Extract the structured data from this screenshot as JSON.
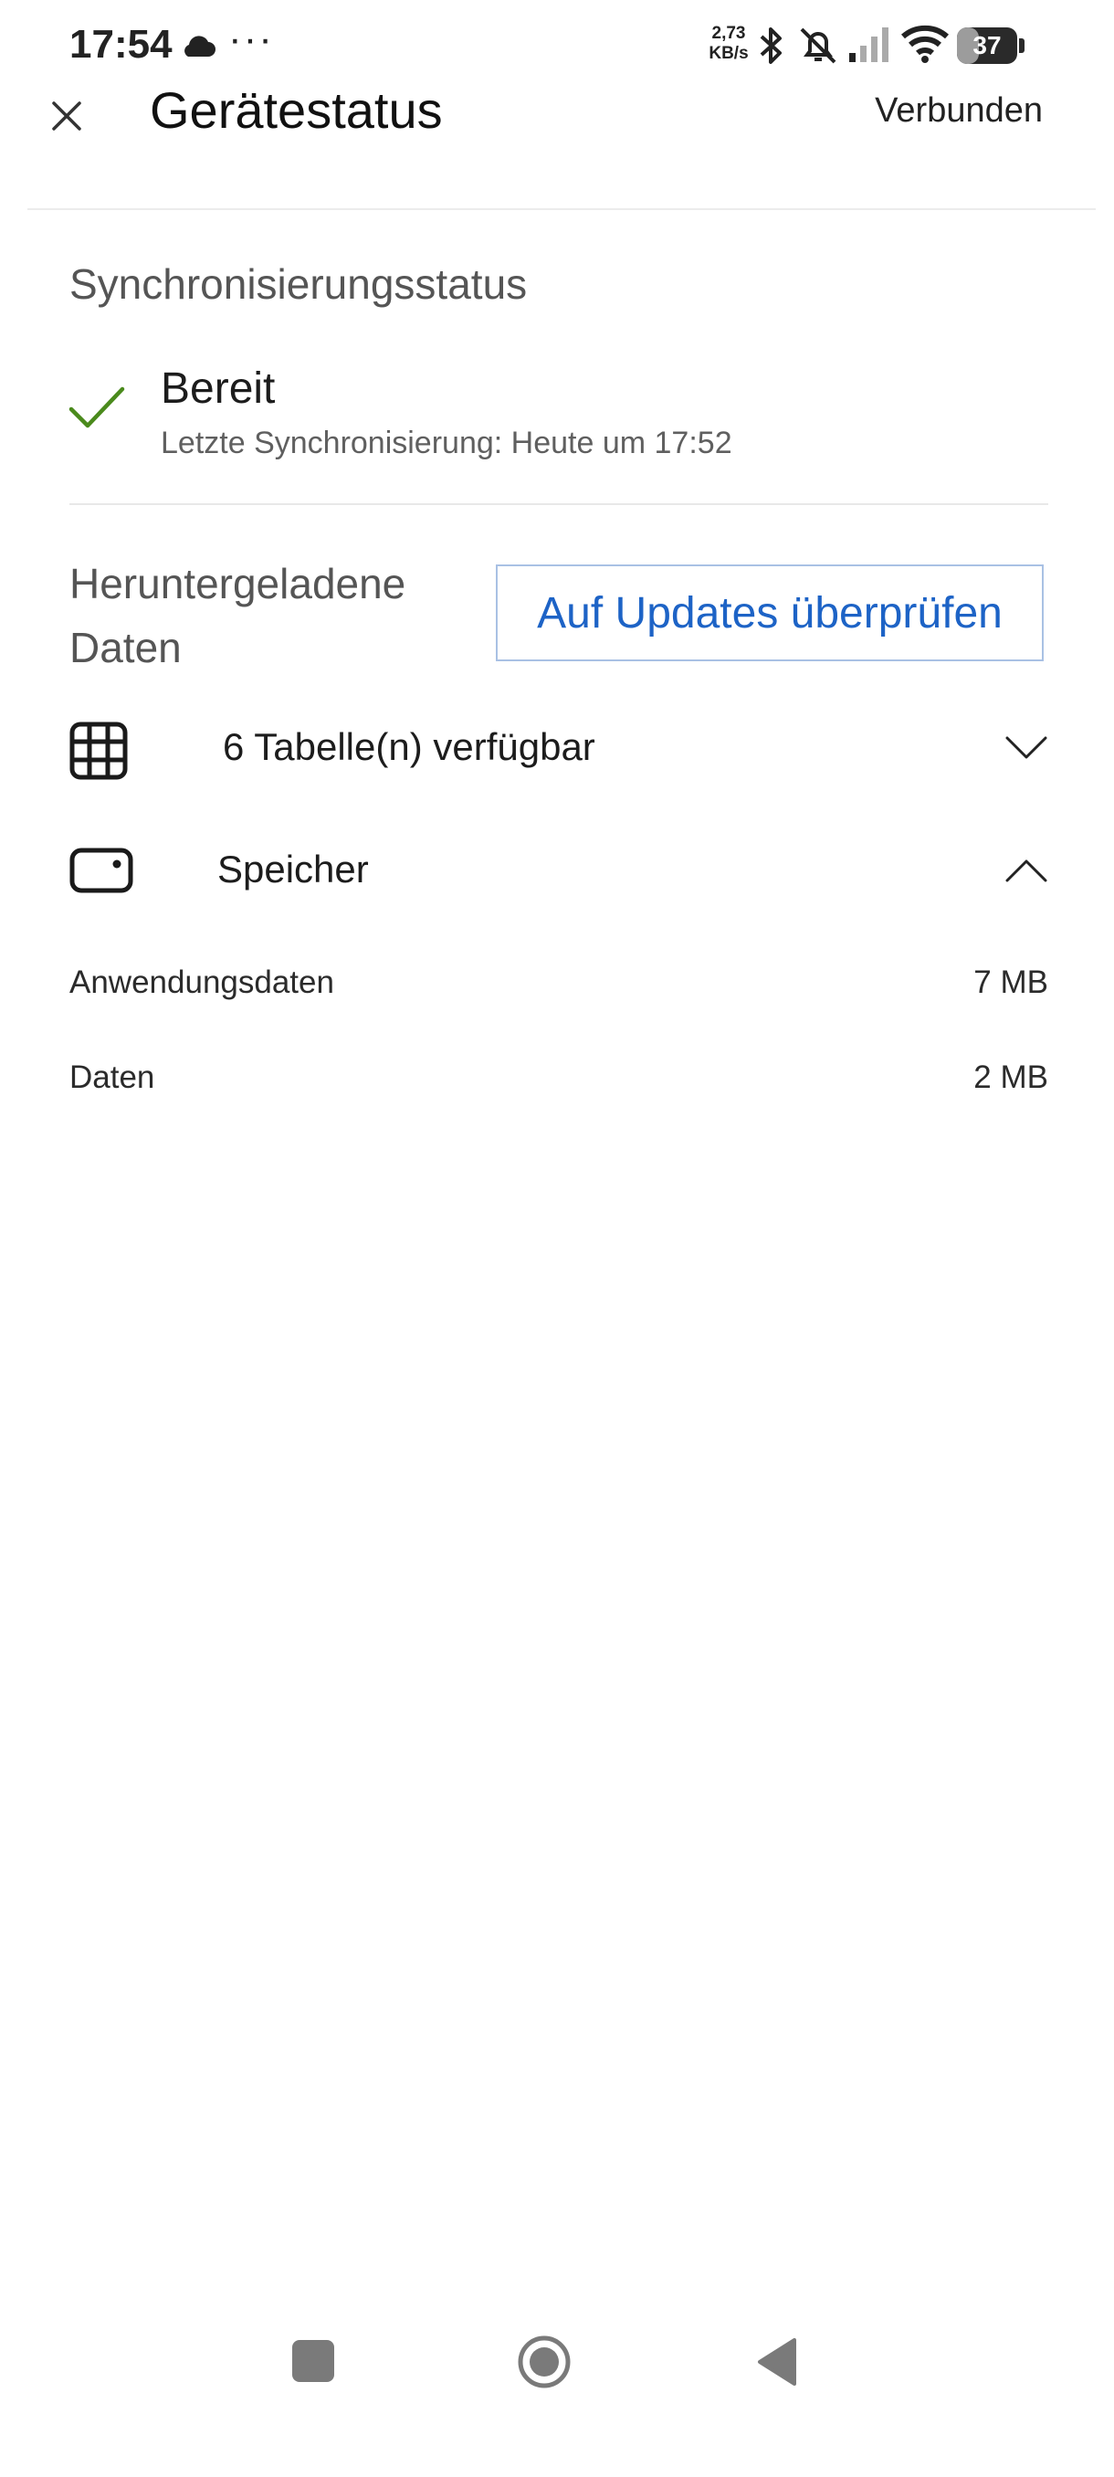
{
  "status_bar": {
    "time": "17:54",
    "net_speed_value": "2,73",
    "net_speed_unit": "KB/s",
    "battery_level": "37",
    "icons": [
      "cloud-icon",
      "more-icon",
      "bluetooth-icon",
      "bell-muted-icon",
      "signal-icon",
      "wifi-icon",
      "battery-icon"
    ]
  },
  "header": {
    "title": "Gerätestatus",
    "connection_status": "Verbunden",
    "close_icon": "close-icon"
  },
  "sync": {
    "heading": "Synchronisierungsstatus",
    "state": "Bereit",
    "last_sync": "Letzte Synchronisierung: Heute um 17:52",
    "status_color": "#4a8a1c"
  },
  "downloaded": {
    "heading": "Heruntergeladene Daten",
    "check_updates_label": "Auf Updates überprüfen",
    "tables_label": "6 Tabelle(n) verfügbar",
    "storage_label": "Speicher",
    "storage_items": [
      {
        "label": "Anwendungsdaten",
        "value": "7 MB"
      },
      {
        "label": "Daten",
        "value": "2 MB"
      }
    ]
  },
  "colors": {
    "accent": "#1d63c6",
    "button_border": "#a9c1e4"
  }
}
